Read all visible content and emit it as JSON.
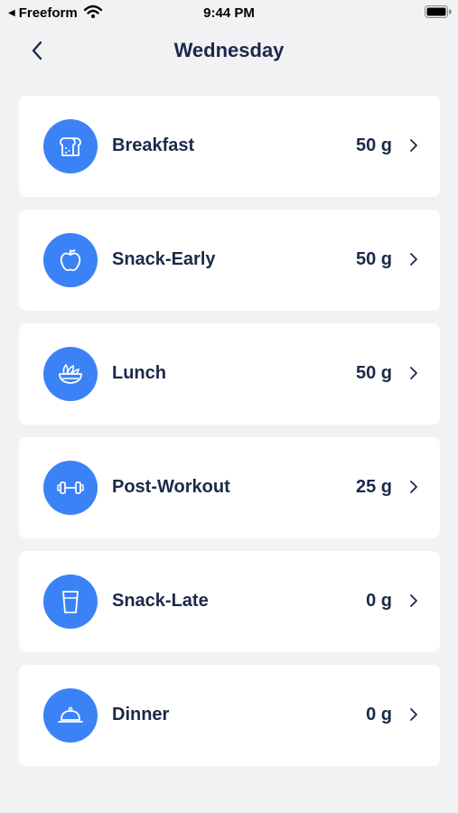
{
  "status_bar": {
    "back_app": "Freeform",
    "time": "9:44 PM"
  },
  "nav": {
    "title": "Wednesday"
  },
  "meals": [
    {
      "name": "Breakfast",
      "amount": "50 g",
      "icon": "bread-icon"
    },
    {
      "name": "Snack-Early",
      "amount": "50 g",
      "icon": "apple-icon"
    },
    {
      "name": "Lunch",
      "amount": "50 g",
      "icon": "salad-bowl-icon"
    },
    {
      "name": "Post-Workout",
      "amount": "25 g",
      "icon": "dumbbell-icon"
    },
    {
      "name": "Snack-Late",
      "amount": "0 g",
      "icon": "glass-icon"
    },
    {
      "name": "Dinner",
      "amount": "0 g",
      "icon": "cloche-icon"
    }
  ],
  "colors": {
    "accent": "#3b82f6",
    "text": "#1b2a4a",
    "background": "#f2f2f4"
  }
}
